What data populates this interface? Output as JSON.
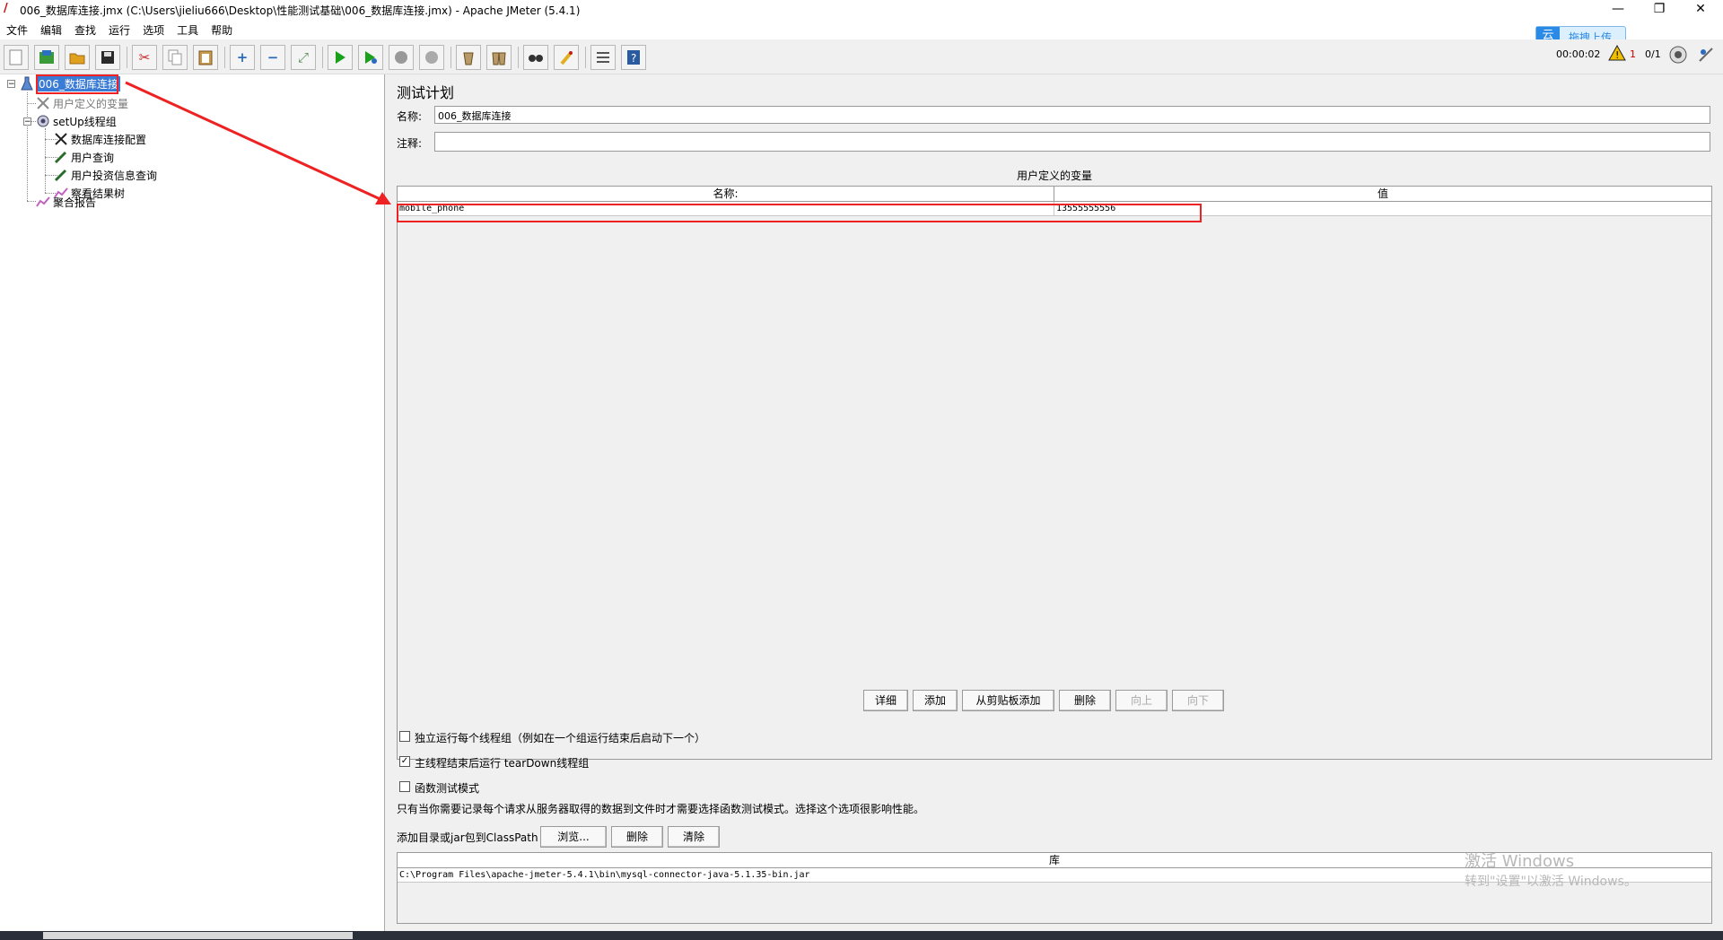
{
  "window": {
    "title": "006_数据库连接.jmx (C:\\Users\\jieliu666\\Desktop\\性能测试基础\\006_数据库连接.jmx) - Apache JMeter (5.4.1)",
    "minimize": "—",
    "restore": "❐",
    "close": "✕"
  },
  "menu": [
    "文件",
    "编辑",
    "查找",
    "运行",
    "选项",
    "工具",
    "帮助"
  ],
  "baidu_upload": {
    "label": "拖拽上传",
    "logo": "云"
  },
  "status": {
    "elapsed": "00:00:02",
    "warnings": "1",
    "threads": "0/1"
  },
  "tree": {
    "root": "006_数据库连接",
    "user_vars": "用户定义的变量",
    "setup_group": "setUp线程组",
    "db_config": "数据库连接配置",
    "user_query": "用户查询",
    "invest_query": "用户投资信息查询",
    "results_tree": "察看结果树",
    "aggregate": "聚合报告"
  },
  "panel": {
    "title": "测试计划",
    "name_label": "名称:",
    "name_value": "006_数据库连接",
    "comment_label": "注释:",
    "comment_value": "",
    "vars_title": "用户定义的变量",
    "vars_columns": [
      "名称:",
      "值"
    ],
    "vars_rows": [
      {
        "name": "mobile_phone",
        "value": "13555555556"
      }
    ],
    "buttons": {
      "detail": "详细",
      "add": "添加",
      "add_clipboard": "从剪贴板添加",
      "delete": "删除",
      "up": "向上",
      "down": "向下"
    },
    "options": {
      "serialize": {
        "label": "独立运行每个线程组（例如在一个组运行结束后启动下一个）",
        "checked": false
      },
      "teardown": {
        "label": "主线程结束后运行 tearDown线程组",
        "checked": true
      },
      "functional": {
        "label": "函数测试模式",
        "checked": false
      }
    },
    "functional_note": "只有当你需要记录每个请求从服务器取得的数据到文件时才需要选择函数测试模式。选择这个选项很影响性能。",
    "classpath_label": "添加目录或jar包到ClassPath",
    "cp_buttons": {
      "browse": "浏览...",
      "delete": "删除",
      "clear": "清除"
    },
    "lib_column": "库",
    "lib_rows": [
      "C:\\Program Files\\apache-jmeter-5.4.1\\bin\\mysql-connector-java-5.1.35-bin.jar"
    ]
  },
  "watermark": {
    "line1": "激活 Windows",
    "line2": "转到\"设置\"以激活 Windows。"
  },
  "colors": {
    "highlight": "#ee2222",
    "selection": "#3a7bd5",
    "accent": "#2b8ae6"
  }
}
